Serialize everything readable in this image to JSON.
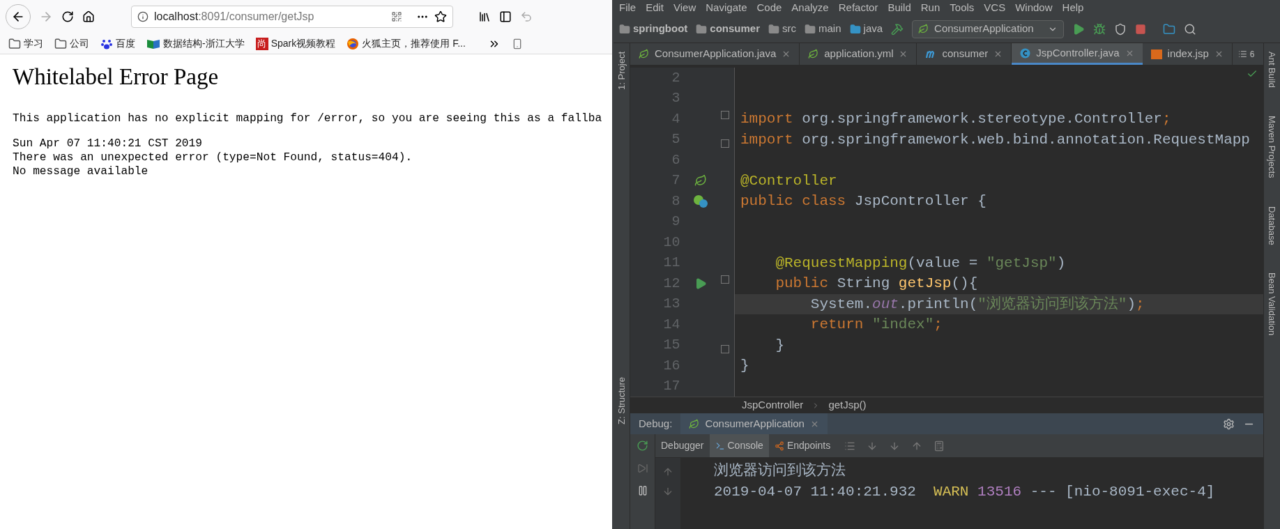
{
  "browser": {
    "url": {
      "host": "localhost",
      "path": ":8091/consumer/getJsp"
    },
    "bookmarks": [
      {
        "label": "学习"
      },
      {
        "label": "公司"
      },
      {
        "label": "百度"
      },
      {
        "label": "数据结构-浙江大学"
      },
      {
        "label": "Spark视频教程",
        "badge": "尚"
      },
      {
        "label": "火狐主页，推荐使用 F..."
      }
    ],
    "page": {
      "title": "Whitelabel Error Page",
      "paragraphs": [
        [
          "This application has no explicit mapping for /error, so you are seeing this as a fallba"
        ],
        [
          "Sun Apr 07 11:40:21 CST 2019",
          "There was an unexpected error (type=Not Found, status=404).",
          "No message available"
        ]
      ]
    }
  },
  "ide": {
    "menu": [
      "File",
      "Edit",
      "View",
      "Navigate",
      "Code",
      "Analyze",
      "Refactor",
      "Build",
      "Run",
      "Tools",
      "VCS",
      "Window",
      "Help"
    ],
    "path": [
      "springboot",
      "consumer",
      "src",
      "main",
      "java"
    ],
    "run_config": "ConsumerApplication",
    "tabs": [
      {
        "label": "ConsumerApplication.java",
        "selected": false
      },
      {
        "label": "application.yml",
        "selected": false
      },
      {
        "label": "consumer",
        "selected": false
      },
      {
        "label": "JspController.java",
        "selected": true
      },
      {
        "label": "index.jsp",
        "selected": false
      }
    ],
    "hidden_tabs": "6",
    "left_tools": [
      "1: Project",
      "Z: Structure"
    ],
    "right_tools": [
      "Ant Build",
      "Maven Projects",
      "Database",
      "Bean Validation"
    ],
    "code": {
      "lines": [
        {
          "number": "2",
          "current": false
        },
        {
          "number": "3",
          "current": false
        },
        {
          "number": "4",
          "tokens": [
            {
              "text": "import",
              "kind": "keyword"
            },
            {
              "text": " org.springframework.stereotype.Controller",
              "kind": "plain"
            },
            {
              "text": ";",
              "kind": "keyword"
            }
          ],
          "current": false
        },
        {
          "number": "5",
          "tokens": [
            {
              "text": "import",
              "kind": "keyword"
            },
            {
              "text": " org.springframework.web.bind.annotation.RequestMapp",
              "kind": "plain"
            }
          ],
          "current": false
        },
        {
          "number": "6",
          "current": false
        },
        {
          "number": "7",
          "tokens": [
            {
              "text": "@Controller",
              "kind": "annotation"
            }
          ],
          "current": false
        },
        {
          "number": "8",
          "tokens": [
            {
              "text": "public class",
              "kind": "keyword"
            },
            {
              "text": " JspController {",
              "kind": "plain"
            }
          ],
          "current": false
        },
        {
          "number": "9",
          "current": false
        },
        {
          "number": "10",
          "current": false
        },
        {
          "number": "11",
          "tokens": [
            {
              "text": "    @RequestMapping",
              "kind": "annotation"
            },
            {
              "text": "(value = ",
              "kind": "plain"
            },
            {
              "text": "\"getJsp\"",
              "kind": "string"
            },
            {
              "text": ")",
              "kind": "plain"
            }
          ],
          "current": false
        },
        {
          "number": "12",
          "tokens": [
            {
              "text": "    public",
              "kind": "keyword"
            },
            {
              "text": " String ",
              "kind": "plain"
            },
            {
              "text": "getJsp",
              "kind": "method"
            },
            {
              "text": "(){",
              "kind": "plain"
            }
          ],
          "current": false
        },
        {
          "number": "13",
          "tokens": [
            {
              "text": "        System.",
              "kind": "plain"
            },
            {
              "text": "out",
              "kind": "field"
            },
            {
              "text": ".println(",
              "kind": "plain"
            },
            {
              "text": "\"浏览器访问到该方法\"",
              "kind": "string"
            },
            {
              "text": ")",
              "kind": "plain"
            },
            {
              "text": ";",
              "kind": "keyword"
            }
          ],
          "current": true
        },
        {
          "number": "14",
          "tokens": [
            {
              "text": "        return ",
              "kind": "keyword"
            },
            {
              "text": "\"index\"",
              "kind": "string"
            },
            {
              "text": ";",
              "kind": "keyword"
            }
          ],
          "current": false
        },
        {
          "number": "15",
          "tokens": [
            {
              "text": "    }",
              "kind": "plain"
            }
          ],
          "current": false
        },
        {
          "number": "16",
          "tokens": [
            {
              "text": "}",
              "kind": "plain"
            }
          ],
          "current": false
        },
        {
          "number": "17",
          "current": false
        }
      ],
      "breadcrumb": [
        "JspController",
        "getJsp()"
      ]
    },
    "debug": {
      "label": "Debug:",
      "session": "ConsumerApplication",
      "tabs": [
        {
          "label": "Debugger",
          "selected": false
        },
        {
          "label": "Console",
          "selected": true
        },
        {
          "label": "Endpoints",
          "selected": false
        }
      ],
      "console": [
        [
          {
            "text": "浏览器访问到该方法",
            "kind": "plain"
          }
        ],
        [
          {
            "text": "2019-04-07 11:40:21.932  ",
            "kind": "plain"
          },
          {
            "text": "WARN ",
            "kind": "warn"
          },
          {
            "text": "13516",
            "kind": "pid"
          },
          {
            "text": " --- [nio-8091-exec-4]",
            "kind": "plain"
          }
        ]
      ]
    }
  }
}
